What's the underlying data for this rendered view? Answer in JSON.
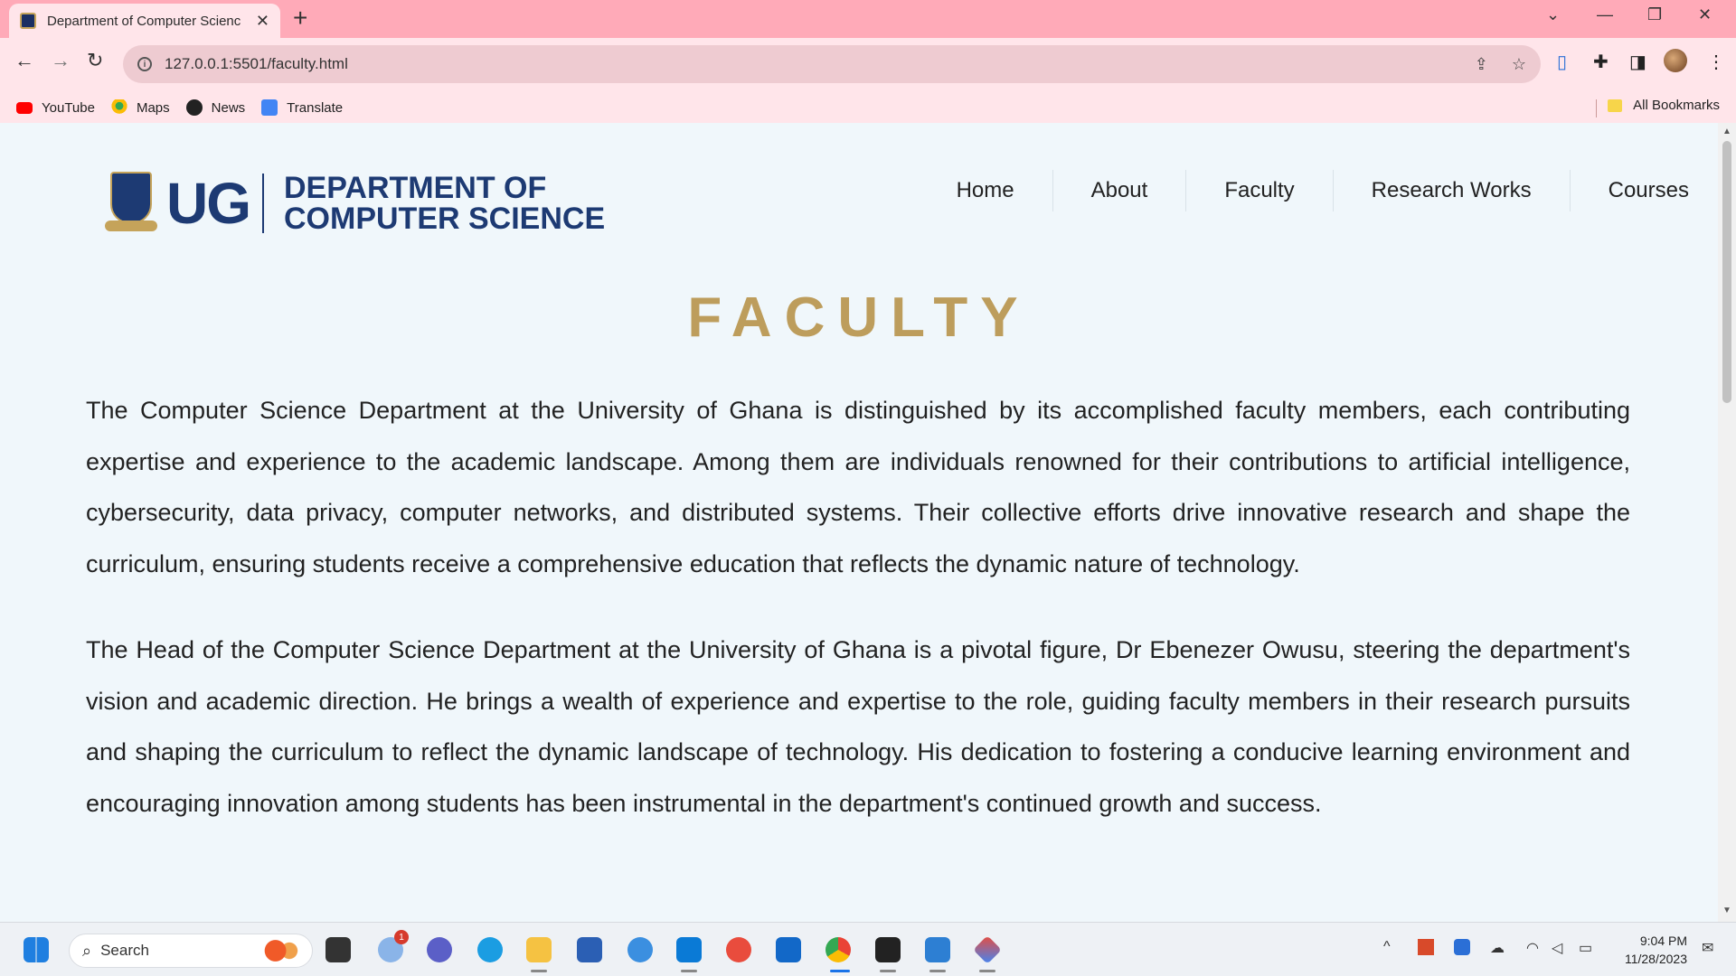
{
  "browser": {
    "tab_title": "Department of Computer Scienc",
    "url": "127.0.0.1:5501/faculty.html",
    "bookmarks": [
      {
        "label": "YouTube",
        "icon": "youtube-icon"
      },
      {
        "label": "Maps",
        "icon": "maps-icon"
      },
      {
        "label": "News",
        "icon": "news-icon"
      },
      {
        "label": "Translate",
        "icon": "translate-icon"
      }
    ],
    "all_bookmarks": "All Bookmarks"
  },
  "site": {
    "logo_ug": "UG",
    "logo_line1": "DEPARTMENT OF",
    "logo_line2": "COMPUTER SCIENCE",
    "nav": [
      "Home",
      "About",
      "Faculty",
      "Research Works",
      "Courses"
    ],
    "heading": "FACULTY",
    "paragraphs": [
      "The Computer Science Department at the University of Ghana is distinguished by its accomplished faculty members, each contributing expertise and experience to the academic landscape. Among them are individuals renowned for their contributions to artificial intelligence, cybersecurity, data privacy, computer networks, and distributed systems. Their collective efforts drive innovative research and shape the curriculum, ensuring students receive a comprehensive education that reflects the dynamic nature of technology.",
      "The Head of the Computer Science Department at the University of Ghana is a pivotal figure, Dr Ebenezer Owusu, steering the department's vision and academic direction. He brings a wealth of experience and expertise to the role, guiding faculty members in their research pursuits and shaping the curriculum to reflect the dynamic landscape of technology. His dedication to fostering a conducive learning environment and encouraging innovation among students has been instrumental in the department's continued growth and success."
    ]
  },
  "taskbar": {
    "search_placeholder": "Search",
    "notification_count": "1",
    "time": "9:04 PM",
    "date": "11/28/2023"
  },
  "colors": {
    "tabbar": "#ffaab8",
    "toolbar": "#ffe5ea",
    "brand_navy": "#1d3a73",
    "heading_gold": "#bd9d5c"
  }
}
